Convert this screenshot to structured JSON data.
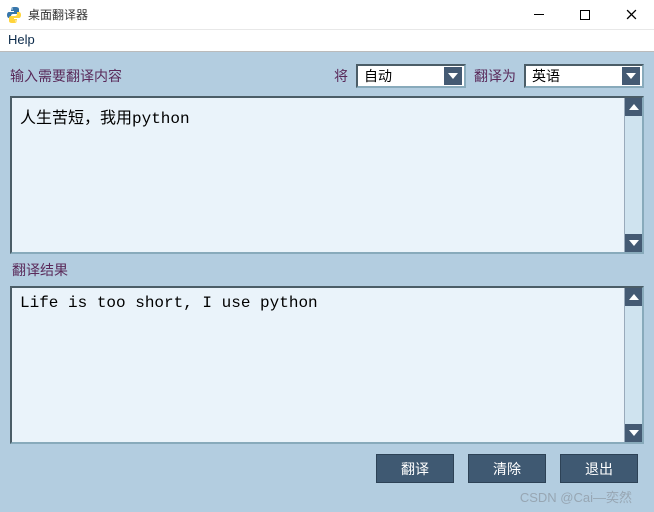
{
  "window": {
    "title": "桌面翻译器"
  },
  "menu": {
    "help": "Help"
  },
  "input_section": {
    "label": "输入需要翻译内容",
    "from_label": "将",
    "from_value": "自动",
    "to_label": "翻译为",
    "to_value": "英语",
    "text": "人生苦短，我用python"
  },
  "output_section": {
    "label": "翻译结果",
    "text": "Life is too short, I use python"
  },
  "buttons": {
    "translate": "翻译",
    "clear": "清除",
    "exit": "退出"
  },
  "watermark": "CSDN @Cai—奕然"
}
